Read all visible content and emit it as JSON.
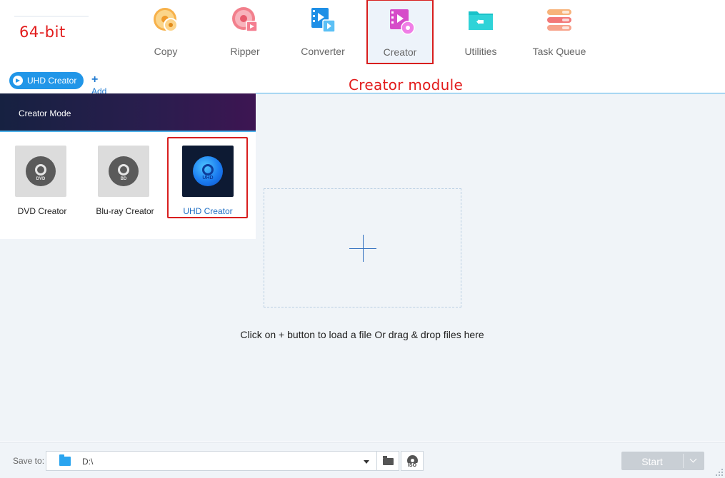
{
  "annotations": {
    "bit_label": "64-bit",
    "module_label": "Creator module",
    "color": "#e21b1b"
  },
  "toolbar": {
    "items": [
      {
        "label": "Copy",
        "icon": "copy-disc-icon"
      },
      {
        "label": "Ripper",
        "icon": "ripper-disc-icon"
      },
      {
        "label": "Converter",
        "icon": "converter-film-icon"
      },
      {
        "label": "Creator",
        "icon": "creator-film-disc-icon",
        "active": true
      },
      {
        "label": "Utilities",
        "icon": "utilities-folder-icon"
      },
      {
        "label": "Task Queue",
        "icon": "task-queue-list-icon"
      }
    ]
  },
  "subtabs": {
    "active_tab": "UHD Creator",
    "add_label": "Add"
  },
  "creator_panel": {
    "header": "Creator Mode",
    "options": [
      {
        "label": "DVD Creator",
        "disc_tag": "DVD"
      },
      {
        "label": "Blu-ray Creator",
        "disc_tag": "BD"
      },
      {
        "label": "UHD Creator",
        "disc_tag": "UHD",
        "selected": true
      }
    ]
  },
  "dropzone": {
    "hint": "Click on + button to load a file Or drag & drop files here"
  },
  "bottom": {
    "save_label": "Save to:",
    "path_value": "D:\\",
    "iso_label": "ISO",
    "start_label": "Start"
  },
  "colors": {
    "accent": "#2196e8",
    "highlight_border": "#d81e1e",
    "main_bg": "#f0f4f8"
  }
}
